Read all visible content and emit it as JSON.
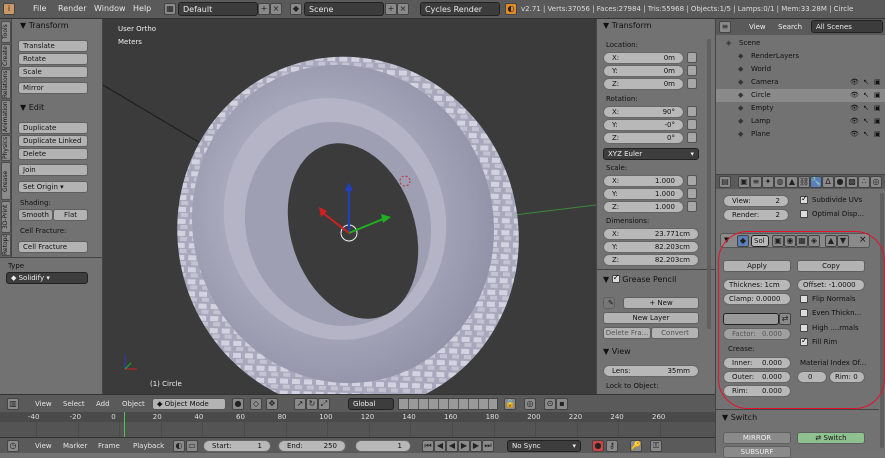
{
  "top": {
    "menus": [
      "File",
      "Render",
      "Window",
      "Help"
    ],
    "layout": "Default",
    "scene": "Scene",
    "engine": "Cycles Render",
    "stats": "v2.71 | Verts:37056 | Faces:27984 | Tris:55968 | Objects:1/5 | Lamps:0/1 | Mem:33.28M | Circle"
  },
  "tool_shelf": {
    "tabs": [
      "Tools",
      "Create",
      "Relations",
      "Animation",
      "Physics",
      "Grease Pencil",
      "3D-Print",
      "Retopo"
    ],
    "transform_title": "Transform",
    "transform": [
      "Translate",
      "Rotate",
      "Scale",
      "Mirror"
    ],
    "edit_title": "Edit",
    "edit": [
      "Duplicate",
      "Duplicate Linked",
      "Delete",
      "Join"
    ],
    "set_origin": "Set Origin",
    "shading_label": "Shading:",
    "smooth": "Smooth",
    "flat": "Flat",
    "cell_fracture_label": "Cell Fracture:",
    "cell_fracture_btn": "Cell Fracture",
    "type_label": "Type",
    "type_value": "Solidify"
  },
  "viewport": {
    "view_name": "User Ortho",
    "units": "Meters",
    "object_label": "(1) Circle"
  },
  "n_panel": {
    "transform_title": "Transform",
    "location_label": "Location:",
    "location": [
      {
        "k": "X:",
        "v": "0m"
      },
      {
        "k": "Y:",
        "v": "0m"
      },
      {
        "k": "Z:",
        "v": "0m"
      }
    ],
    "rotation_label": "Rotation:",
    "rotation": [
      {
        "k": "X:",
        "v": "90°"
      },
      {
        "k": "Y:",
        "v": "-0°"
      },
      {
        "k": "Z:",
        "v": "0°"
      }
    ],
    "rotation_mode": "XYZ Euler",
    "scale_label": "Scale:",
    "scale": [
      {
        "k": "X:",
        "v": "1.000"
      },
      {
        "k": "Y:",
        "v": "1.000"
      },
      {
        "k": "Z:",
        "v": "1.000"
      }
    ],
    "dimensions_label": "Dimensions:",
    "dimensions": [
      {
        "k": "X:",
        "v": "23.771cm"
      },
      {
        "k": "Y:",
        "v": "82.203cm"
      },
      {
        "k": "Z:",
        "v": "82.203cm"
      }
    ],
    "grease_title": "Grease Pencil",
    "new": "New",
    "new_layer": "New Layer",
    "delete_frame": "Delete Fra...",
    "convert": "Convert",
    "view_title": "View",
    "lens_label": "Lens:",
    "lens_value": "35mm",
    "lock_label": "Lock to Object:"
  },
  "outliner": {
    "menus": [
      "View",
      "Search"
    ],
    "filter": "All Scenes",
    "items": [
      {
        "name": "Scene",
        "indent": 0
      },
      {
        "name": "RenderLayers",
        "indent": 1
      },
      {
        "name": "World",
        "indent": 1
      },
      {
        "name": "Camera",
        "indent": 1
      },
      {
        "name": "Circle",
        "indent": 1
      },
      {
        "name": "Empty",
        "indent": 1
      },
      {
        "name": "Lamp",
        "indent": 1
      },
      {
        "name": "Plane",
        "indent": 1
      }
    ]
  },
  "properties": {
    "view_label": "View:",
    "view_value": "2",
    "render_label": "Render:",
    "render_value": "2",
    "subdivide_uvs": "Subdivide UVs",
    "optimal_display": "Optimal Disp...",
    "modifier_name": "Sol",
    "apply": "Apply",
    "copy": "Copy",
    "thickness": "Thicknes: 1cm",
    "offset": "Offset: -1.0000",
    "clamp": "Clamp: 0.0000",
    "flip_normals": "Flip Normals",
    "even_thickness": "Even Thickn...",
    "high_quality": "High ....rmals",
    "factor": "Factor:",
    "factor_value": "0.000",
    "fill_rim": "Fill Rim",
    "crease_label": "Crease:",
    "inner_label": "Inner:",
    "inner_value": "0.000",
    "outer_label": "Outer:",
    "outer_value": "0.000",
    "rim_label": "Rim:",
    "rim_value": "0.000",
    "material_label": "Material Index Of...",
    "mat_a": "0",
    "mat_rim": "Rim: 0",
    "switch_title": "Switch",
    "mirror": "MIRROR",
    "switch_btn": "Switch",
    "subsurf": "SUBSURF"
  },
  "view3d_header": {
    "menus": [
      "View",
      "Select",
      "Add",
      "Object"
    ],
    "mode": "Object Mode",
    "orientation": "Global"
  },
  "timeline": {
    "ticks": [
      "-40",
      "-20",
      "0",
      "20",
      "40",
      "60",
      "80",
      "100",
      "120",
      "140",
      "160",
      "180",
      "200",
      "220",
      "240",
      "260"
    ],
    "menus": [
      "View",
      "Marker",
      "Frame",
      "Playback"
    ],
    "start": "Start:",
    "start_value": "1",
    "end": "End:",
    "end_value": "250",
    "current": "1",
    "sync": "No Sync"
  },
  "colors": {
    "highlight": "#e8102b",
    "panel": "#727272",
    "viewport": "#3b3b3b"
  }
}
